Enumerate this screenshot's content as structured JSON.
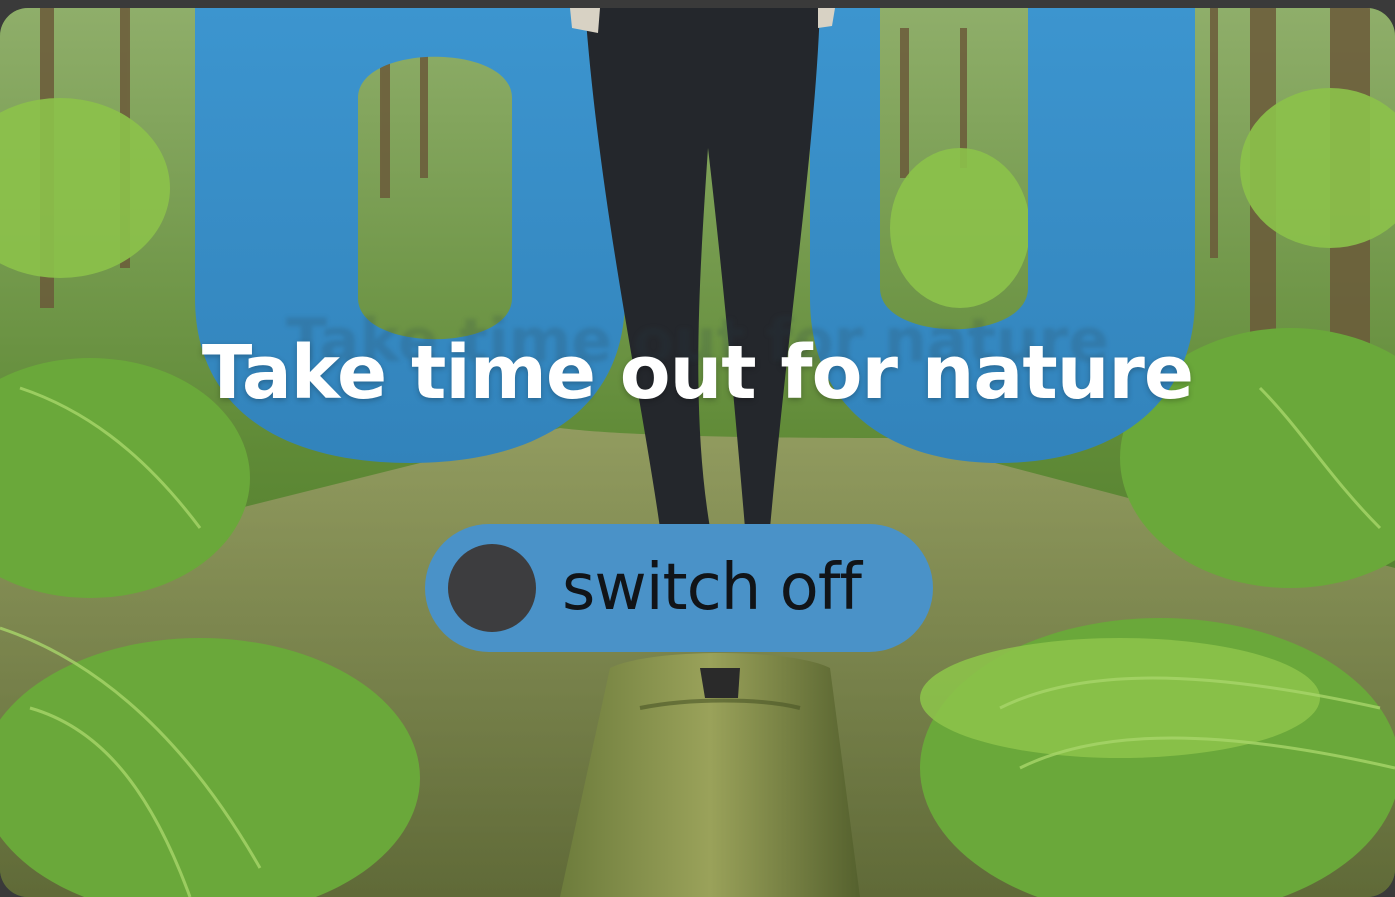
{
  "headline": "Take time out for nature",
  "toggle": {
    "label": "switch off",
    "state": "off"
  },
  "colors": {
    "accent_blue": "#3a8fc6",
    "toggle_bg": "#4a92c8",
    "knob": "#3d3d3f",
    "headline_text": "#ffffff",
    "label_text": "#111418"
  }
}
